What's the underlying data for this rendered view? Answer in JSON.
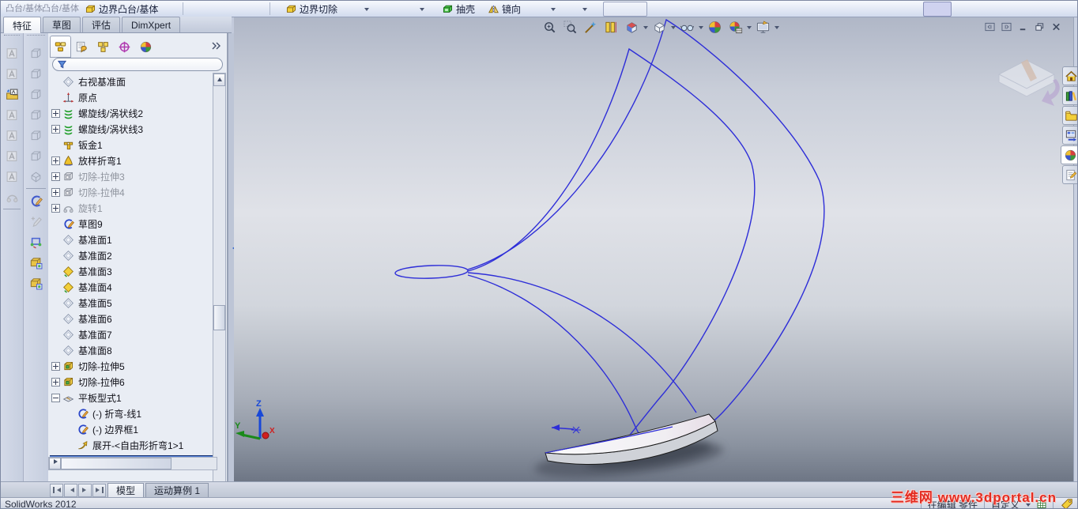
{
  "app": {
    "version_label": "SolidWorks 2012"
  },
  "top_toolbar": {
    "clipped_fragments": [
      "凸台/基体",
      "凸台/基体"
    ],
    "boundary_boss_label": "边界凸台/基体",
    "boundary_cut_label": "边界切除",
    "shell_label": "抽壳",
    "mirror_label": "镜向",
    "icons": [
      "boundary-boss-icon",
      "boundary-cut-icon",
      "shell-icon",
      "mirror-icon",
      "dropdown-carets"
    ]
  },
  "command_tabs": {
    "features": "特征",
    "sketch": "草图",
    "evaluate": "评估",
    "dimxpert": "DimXpert",
    "active_tab": "特征"
  },
  "feature_manager": {
    "tab_icons": [
      "featuremanager-tree-icon",
      "propertymanager-icon",
      "configurationmanager-icon",
      "dimxpertmanager-icon",
      "displaymanager-icon",
      "overflow-chevron-icon"
    ],
    "filter_icon": "filter-funnel-icon",
    "filter_value": "",
    "items": [
      {
        "label": "右视基准面",
        "icon": "plane-icon"
      },
      {
        "label": "原点",
        "icon": "origin-icon"
      },
      {
        "label": "螺旋线/涡状线2",
        "icon": "helix-icon",
        "expand": "plus"
      },
      {
        "label": "螺旋线/涡状线3",
        "icon": "helix-icon",
        "expand": "plus"
      },
      {
        "label": "钣金1",
        "icon": "sheet-metal-icon"
      },
      {
        "label": "放样折弯1",
        "icon": "lofted-bend-icon",
        "expand": "plus"
      },
      {
        "label": "切除-拉伸3",
        "icon": "cut-extrude-icon",
        "expand": "plus",
        "suppressed": true
      },
      {
        "label": "切除-拉伸4",
        "icon": "cut-extrude-icon",
        "expand": "plus",
        "suppressed": true
      },
      {
        "label": "旋转1",
        "icon": "revolve-icon",
        "expand": "plus",
        "suppressed": true
      },
      {
        "label": "草图9",
        "icon": "sketch-icon"
      },
      {
        "label": "基准面1",
        "icon": "plane-icon"
      },
      {
        "label": "基准面2",
        "icon": "plane-icon"
      },
      {
        "label": "基准面3",
        "icon": "plane-highlight-icon"
      },
      {
        "label": "基准面4",
        "icon": "plane-highlight-icon"
      },
      {
        "label": "基准面5",
        "icon": "plane-icon"
      },
      {
        "label": "基准面6",
        "icon": "plane-icon"
      },
      {
        "label": "基准面7",
        "icon": "plane-icon"
      },
      {
        "label": "基准面8",
        "icon": "plane-icon"
      },
      {
        "label": "切除-拉伸5",
        "icon": "cut-extrude-gold-icon",
        "expand": "plus"
      },
      {
        "label": "切除-拉伸6",
        "icon": "cut-extrude-gold-icon",
        "expand": "plus"
      },
      {
        "label": "平板型式1",
        "icon": "flat-pattern-icon",
        "expand": "minus"
      },
      {
        "label": "(-) 折弯-线1",
        "icon": "sketch-icon",
        "child": true
      },
      {
        "label": "(-) 边界框1",
        "icon": "sketch-icon",
        "child": true
      },
      {
        "label": "展开-<自由形折弯1>1",
        "icon": "unfold-icon",
        "child": true
      }
    ]
  },
  "headsup_toolbar": {
    "icons": [
      "zoom-to-fit-icon",
      "zoom-to-area-icon",
      "magic-wand-icon",
      "section-view-icon",
      "view-orientation-icon",
      "display-style-icon",
      "hide-show-items-icon",
      "edit-appearance-icon",
      "apply-scene-icon",
      "view-settings-icon"
    ]
  },
  "window_controls": {
    "icons": [
      "pane-left-icon",
      "pane-right-icon",
      "minimize-icon",
      "restore-icon",
      "close-icon"
    ]
  },
  "task_pane": {
    "icons": [
      "home-icon",
      "design-library-icon",
      "file-explorer-icon",
      "view-palette-icon",
      "appearances-scenes-icon",
      "custom-properties-icon"
    ],
    "active": "appearances-scenes-icon"
  },
  "doc_tabs": {
    "model": "模型",
    "motion_study": "运动算例 1",
    "active_tab": "模型"
  },
  "status_bar": {
    "app_version": "SolidWorks 2012",
    "editing": "在编辑 零件",
    "custom": "自定义",
    "watermark": "三维网 www.3dportal.cn",
    "tag_icon": "yellow-tag-icon"
  },
  "triad": {
    "x": "X",
    "y": "Y",
    "z": "Z"
  },
  "viewport": {
    "curve_color": "#2e2ed8",
    "content": "conical helix curves with flattened sheet-metal part and drop shadow"
  }
}
